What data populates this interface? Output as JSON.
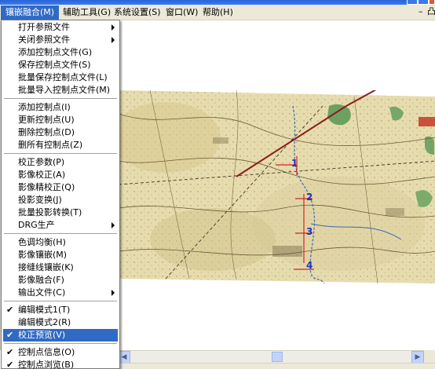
{
  "menubar": {
    "items": [
      {
        "label": "镶嵌融合(M)",
        "active": true
      },
      {
        "label": "辅助工具(G)",
        "active": false
      },
      {
        "label": "系统设置(S)",
        "active": false
      },
      {
        "label": "窗口(W)",
        "active": false
      },
      {
        "label": "帮助(H)",
        "active": false
      }
    ],
    "mdi_minimize": "–",
    "mdi_restore": "凸"
  },
  "dropdown": {
    "groups": [
      [
        {
          "label": "打开参照文件",
          "submenu": true
        },
        {
          "label": "关闭参照文件",
          "submenu": true
        },
        {
          "label": "添加控制点文件(G)"
        },
        {
          "label": "保存控制点文件(S)"
        },
        {
          "label": "批量保存控制点文件(L)"
        },
        {
          "label": "批量导入控制点文件(M)"
        }
      ],
      [
        {
          "label": "添加控制点(I)"
        },
        {
          "label": "更新控制点(U)"
        },
        {
          "label": "删除控制点(D)"
        },
        {
          "label": "删所有控制点(Z)"
        }
      ],
      [
        {
          "label": "校正参数(P)"
        },
        {
          "label": "影像校正(A)"
        },
        {
          "label": "影像精校正(Q)"
        },
        {
          "label": "投影变换(J)"
        },
        {
          "label": "批量投影转换(T)"
        },
        {
          "label": "DRG生产",
          "submenu": true
        }
      ],
      [
        {
          "label": "色调均衡(H)"
        },
        {
          "label": "影像镶嵌(M)"
        },
        {
          "label": "接缝线镶嵌(K)"
        },
        {
          "label": "影像融合(F)"
        },
        {
          "label": "输出文件(C)",
          "submenu": true
        }
      ],
      [
        {
          "label": "编辑模式1(T)",
          "checked": true
        },
        {
          "label": "编辑模式2(R)"
        },
        {
          "label": "校正预览(V)",
          "checked": true,
          "selected": true
        }
      ],
      [
        {
          "label": "控制点信息(O)",
          "checked": true
        },
        {
          "label": "控制点浏览(B)",
          "checked": true
        }
      ]
    ]
  },
  "map": {
    "control_points": [
      {
        "label": "1"
      },
      {
        "label": "2"
      },
      {
        "label": "3"
      },
      {
        "label": "4"
      }
    ]
  }
}
